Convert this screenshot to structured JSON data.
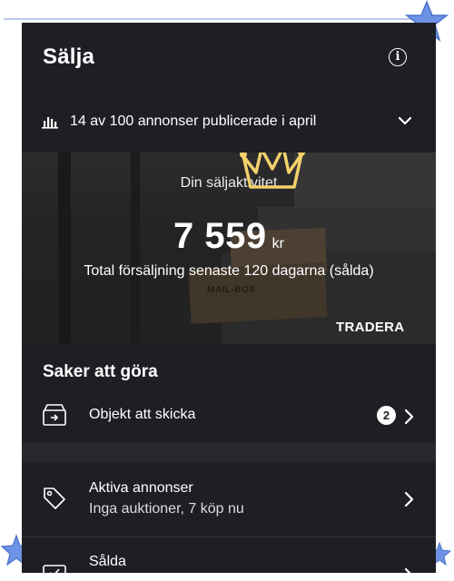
{
  "header": {
    "title": "Sälja",
    "info_icon": "info-icon"
  },
  "stats": {
    "text": "14 av 100 annonser publicerade i april",
    "icon": "bar-chart-icon"
  },
  "hero": {
    "subtitle": "Din säljaktivitet",
    "amount": "7 559",
    "currency": "kr",
    "caption": "Total försäljning senaste 120 dagarna (sålda)",
    "brand": "TRADERA",
    "box_label": "MAIL-BOX"
  },
  "todo": {
    "title": "Saker att göra",
    "items": [
      {
        "label": "Objekt att skicka",
        "badge": "2",
        "icon": "shipping-box-icon"
      },
      {
        "label": "Aktiva annonser",
        "sublabel": "Inga auktioner, 7 köp nu",
        "icon": "price-tag-icon"
      },
      {
        "label": "Sålda",
        "icon": "sold-icon"
      }
    ]
  },
  "colors": {
    "background": "#1d1f25",
    "text": "#ffffff",
    "badge": "#ffffff"
  }
}
